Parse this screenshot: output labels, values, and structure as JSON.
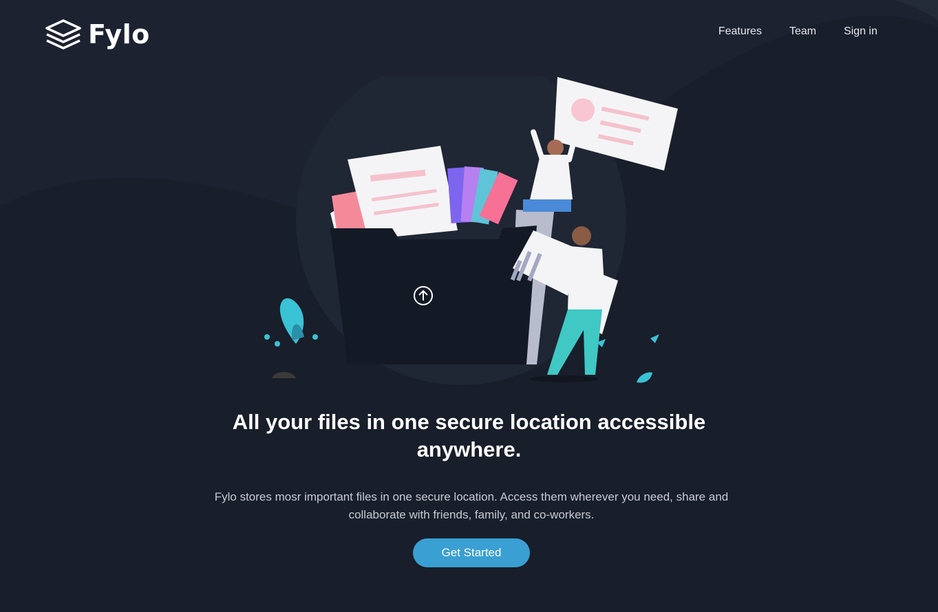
{
  "header": {
    "brand": "Fylo",
    "nav": [
      {
        "label": "Features"
      },
      {
        "label": "Team"
      },
      {
        "label": "Sign in"
      }
    ]
  },
  "hero": {
    "title": "All your files in one secure location accessible anywhere.",
    "description": "Fylo stores mosr important files in one secure location. Access them wherever you need, share and collaborate with friends, family, and co-workers.",
    "cta_label": "Get Started",
    "illustration_icon": "upload-arrow-icon"
  },
  "colors": {
    "background": "#1c2230",
    "background_curve": "#181e2a",
    "accent": "#3a9fd2",
    "text_muted": "#c7cbd4"
  }
}
